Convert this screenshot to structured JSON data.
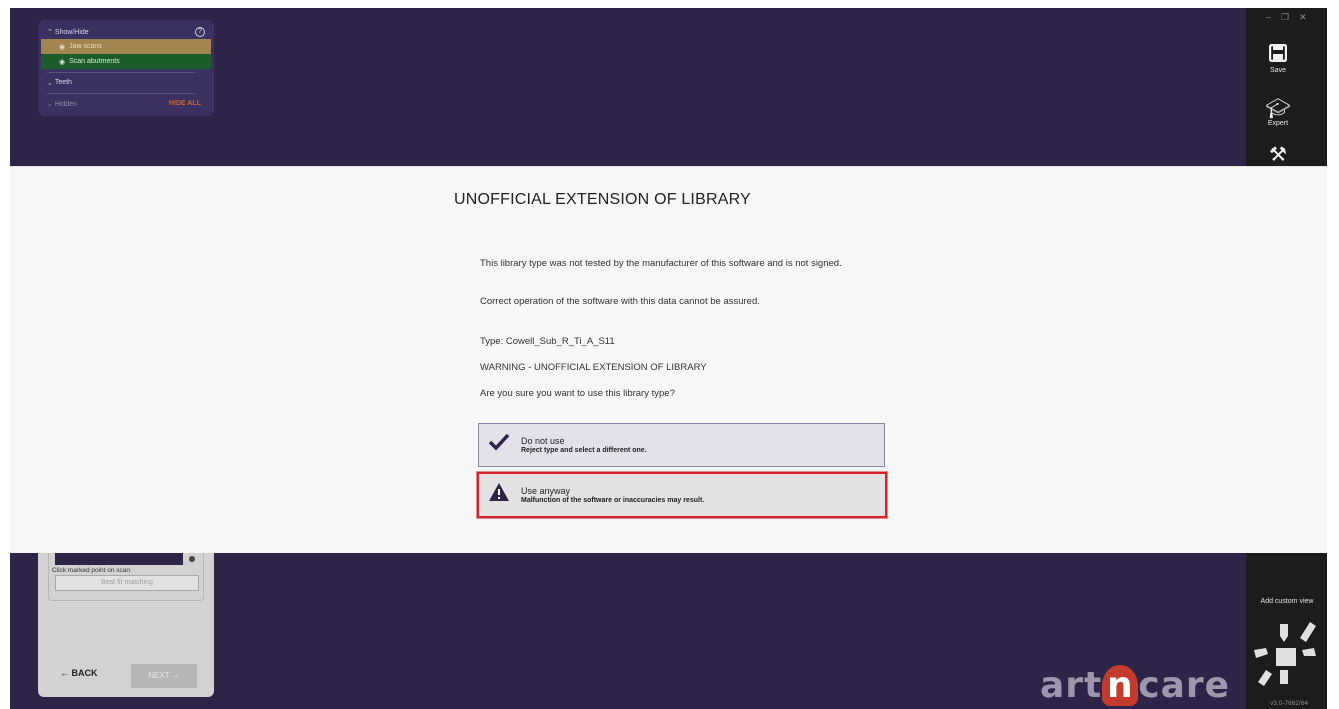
{
  "show_hide": {
    "title": "Show/Hide",
    "help_icon": "?",
    "items": [
      {
        "label": "Jaw scans",
        "color": "#a2844e"
      },
      {
        "label": "Scan abutments",
        "color": "#1a5c2a"
      }
    ],
    "teeth_label": "Teeth",
    "hidden_label": "Hidden",
    "hide_all_label": "HIDE ALL"
  },
  "toolbar": {
    "save_label": "Save",
    "expert_label": "Expert"
  },
  "dialog": {
    "title": "UNOFFICIAL EXTENSION OF LIBRARY",
    "message1": "This library type was not tested by the manufacturer of this software and is not signed.",
    "message2": "Correct operation of the software with this data cannot be assured.",
    "type_line": "Type: Cowell_Sub_R_Ti_A_S11",
    "warning_line": "WARNING - UNOFFICIAL EXTENSION OF LIBRARY",
    "question": "Are you sure you want to use this library type?",
    "options": [
      {
        "title": "Do not use",
        "subtitle": "Reject type and select a different one.",
        "icon": "check-icon"
      },
      {
        "title": "Use anyway",
        "subtitle": "Malfunction of the software or inaccuracies may result.",
        "icon": "warning-icon"
      }
    ]
  },
  "bottom_panel": {
    "hint": "Click marked point on scan",
    "best_fit_label": "Best fit matching",
    "back_label": "← BACK",
    "next_label": "NEXT →"
  },
  "logo_text": {
    "left": "art",
    "middle": "n",
    "right": "care"
  },
  "add_view_label": "Add custom view",
  "version": "v3.0-7662/64",
  "colors": {
    "stage": "#2d2448",
    "accent_red": "#d8202a",
    "logo_red": "#c23b2c"
  }
}
